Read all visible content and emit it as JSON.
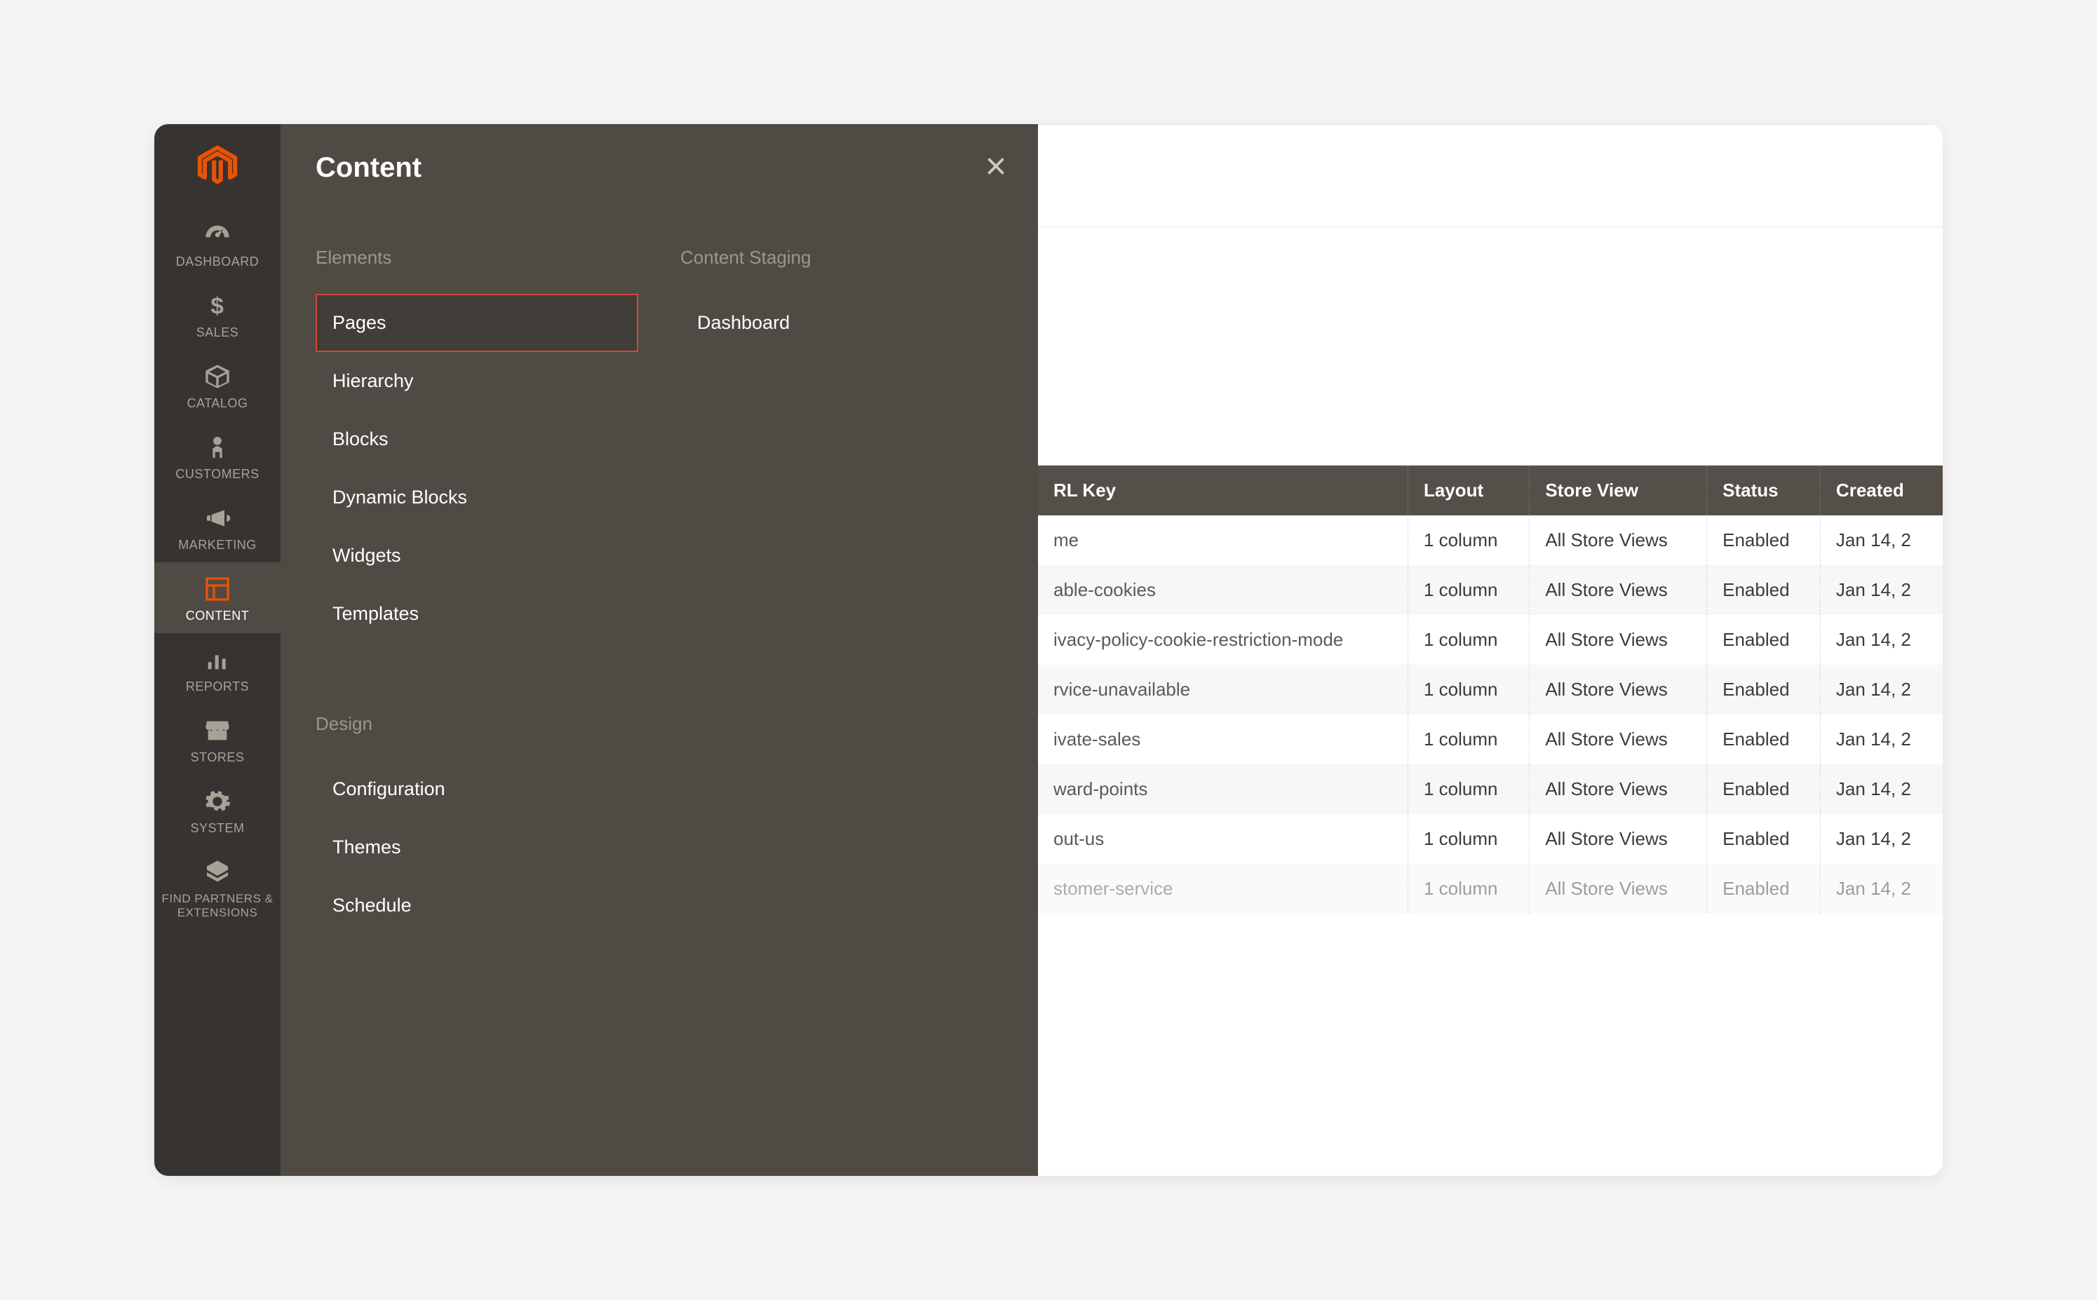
{
  "iconbar": {
    "items": [
      {
        "label": "DASHBOARD"
      },
      {
        "label": "SALES"
      },
      {
        "label": "CATALOG"
      },
      {
        "label": "CUSTOMERS"
      },
      {
        "label": "MARKETING"
      },
      {
        "label": "CONTENT"
      },
      {
        "label": "REPORTS"
      },
      {
        "label": "STORES"
      },
      {
        "label": "SYSTEM"
      },
      {
        "label": "FIND PARTNERS & EXTENSIONS"
      }
    ]
  },
  "flyout": {
    "title": "Content",
    "groups": [
      {
        "title": "Elements",
        "links": [
          "Pages",
          "Hierarchy",
          "Blocks",
          "Dynamic Blocks",
          "Widgets",
          "Templates"
        ]
      },
      {
        "title": "Design",
        "links": [
          "Configuration",
          "Themes",
          "Schedule"
        ]
      }
    ],
    "staging": {
      "title": "Content Staging",
      "links": [
        "Dashboard"
      ]
    }
  },
  "grid": {
    "headers": [
      "RL Key",
      "Layout",
      "Store View",
      "Status",
      "Created"
    ],
    "rows": [
      {
        "urlkey": "me",
        "layout": "1 column",
        "storeview": "All Store Views",
        "status": "Enabled",
        "created": "Jan 14, 2"
      },
      {
        "urlkey": "able-cookies",
        "layout": "1 column",
        "storeview": "All Store Views",
        "status": "Enabled",
        "created": "Jan 14, 2"
      },
      {
        "urlkey": "ivacy-policy-cookie-restriction-mode",
        "layout": "1 column",
        "storeview": "All Store Views",
        "status": "Enabled",
        "created": "Jan 14, 2"
      },
      {
        "urlkey": "rvice-unavailable",
        "layout": "1 column",
        "storeview": "All Store Views",
        "status": "Enabled",
        "created": "Jan 14, 2"
      },
      {
        "urlkey": "ivate-sales",
        "layout": "1 column",
        "storeview": "All Store Views",
        "status": "Enabled",
        "created": "Jan 14, 2"
      },
      {
        "urlkey": "ward-points",
        "layout": "1 column",
        "storeview": "All Store Views",
        "status": "Enabled",
        "created": "Jan 14, 2"
      },
      {
        "urlkey": "out-us",
        "layout": "1 column",
        "storeview": "All Store Views",
        "status": "Enabled",
        "created": "Jan 14, 2"
      },
      {
        "urlkey": "stomer-service",
        "layout": "1 column",
        "storeview": "All Store Views",
        "status": "Enabled",
        "created": "Jan 14, 2"
      }
    ]
  }
}
